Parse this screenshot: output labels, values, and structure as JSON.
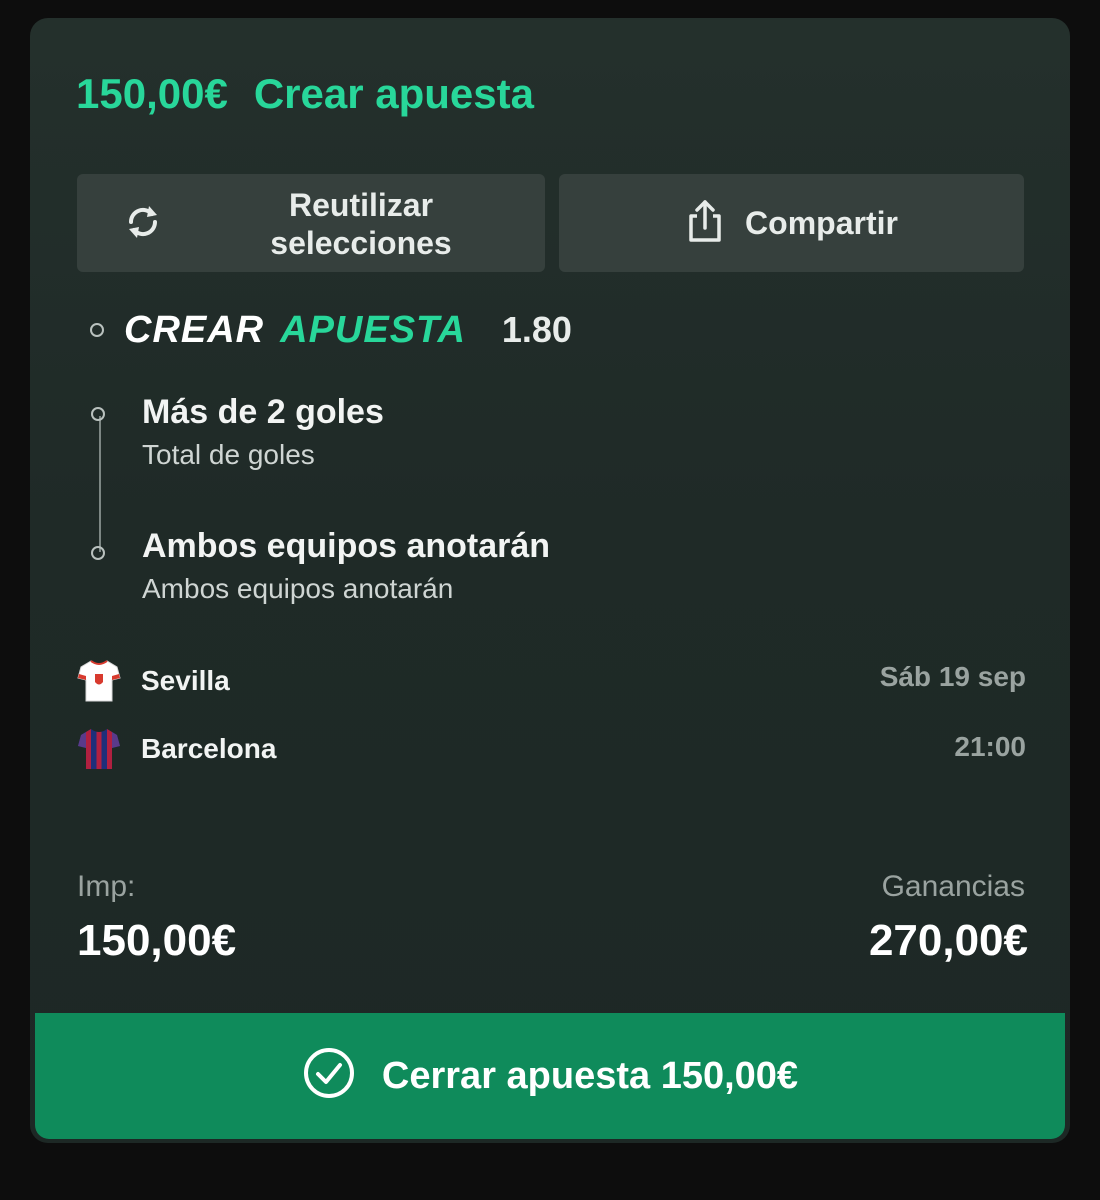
{
  "header": {
    "amount": "150,00€",
    "title": "Crear apuesta"
  },
  "actions": {
    "reuse_label": "Reutilizar selecciones",
    "share_label": "Compartir"
  },
  "builder": {
    "word1": "CREAR",
    "word2": "APUESTA",
    "odds": "1.80"
  },
  "selections": [
    {
      "title": "Más de 2 goles",
      "subtitle": "Total de goles"
    },
    {
      "title": "Ambos equipos anotarán",
      "subtitle": "Ambos equipos anotarán"
    }
  ],
  "match": {
    "home": "Sevilla",
    "away": "Barcelona",
    "date": "Sáb 19 sep",
    "time": "21:00"
  },
  "stake": {
    "label": "Imp:",
    "value": "150,00€"
  },
  "winnings": {
    "label": "Ganancias",
    "value": "270,00€"
  },
  "place_button": {
    "label": "Cerrar apuesta 150,00€"
  },
  "colors": {
    "accent": "#28d79a",
    "button_green": "#0f8b5b",
    "card_bg": "#222d2a",
    "secondary_button": "#36403d"
  },
  "icons": {
    "reuse": "refresh-icon",
    "share": "share-icon",
    "place": "check-circle-icon",
    "home_shirt": "sevilla-shirt-icon",
    "away_shirt": "barcelona-shirt-icon"
  }
}
